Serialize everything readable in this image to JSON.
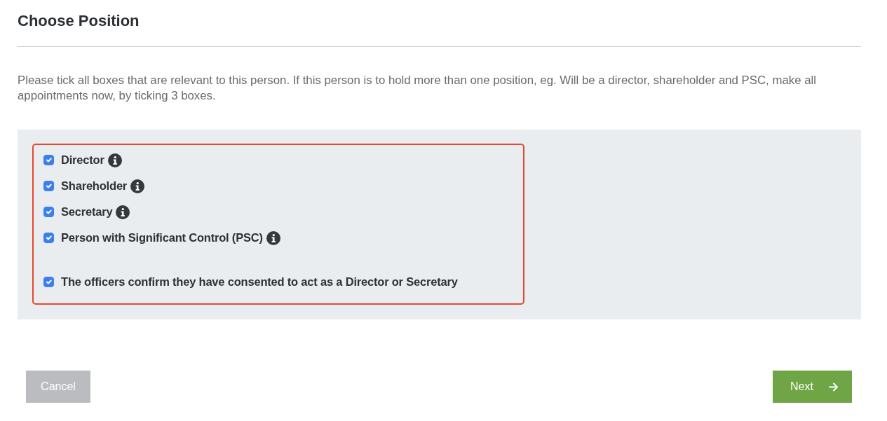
{
  "title": "Choose Position",
  "instructions": "Please tick all boxes that are relevant to this person. If this person is to hold more than one position, eg. Will be a director, shareholder and PSC, make all appointments now, by ticking 3 boxes.",
  "positions": [
    {
      "label": "Director",
      "checked": true
    },
    {
      "label": "Shareholder",
      "checked": true
    },
    {
      "label": "Secretary",
      "checked": true
    },
    {
      "label": "Person with Significant Control (PSC)",
      "checked": true
    }
  ],
  "consent": {
    "label": "The officers confirm they have consented to act as a Director or Secretary",
    "checked": true
  },
  "buttons": {
    "cancel": "Cancel",
    "next": "Next"
  }
}
